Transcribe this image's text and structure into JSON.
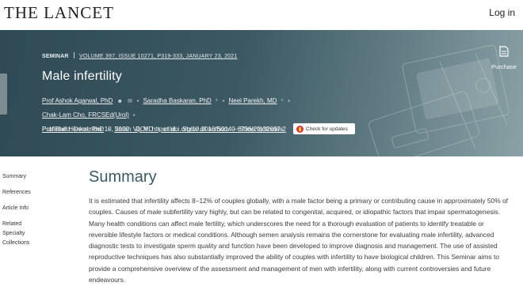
{
  "header": {
    "logo": "THE LANCET",
    "login": "Log in"
  },
  "article": {
    "section": "SEMINAR",
    "volume_info": "VOLUME 397, ISSUE 10271, P319-333, JANUARY 23, 2021",
    "title": "Male infertility",
    "authors": [
      "Prof Ashok Agarwal, PhD",
      "Saradha Baskaran, PhD",
      "Neel Parekh, MD",
      "Chak-Lam Cho, FRCSEd(Urol)",
      "Prof Ralf Henkel, PhD",
      "Sarah Vij, MD"
    ],
    "et_al": "et al.",
    "show_all_authors": "Show all authors",
    "show_footnotes": "Show footnotes",
    "published_label": "Published:",
    "published_date": "December 10, 2020",
    "doi_label": "DOI:",
    "doi": "https://doi.org/10.1016/S0140-6736(20)32667-2",
    "check_updates": "Check for updates",
    "purchase": "Purchase"
  },
  "nav": {
    "items": [
      "Summary",
      "References",
      "Article Info",
      "Related",
      "Specialty",
      "Collections"
    ]
  },
  "summary": {
    "heading": "Summary",
    "text": "It is estimated that infertility affects 8–12% of couples globally, with a male factor being a primary or contributing cause in approximately 50% of couples. Causes of male subfertility vary highly, but can be related to congenital, acquired, or idiopathic factors that impair spermatogenesis. Many health conditions can affect male fertility, which underscores the need for a thorough evaluation of patients to identify treatable or reversible lifestyle factors or medical conditions. Although semen analysis remains the cornerstone for evaluating male infertility, advanced diagnostic tests to investigate sperm quality and function have been developed to improve diagnosis and management. The use of assisted reproductive techniques has also substantially improved the ability of couples with infertility to have biological children. This Seminar aims to provide a comprehensive overview of the assessment and management of men with infertility, along with current controversies and future endeavours."
  },
  "colors": {
    "hero_dark": "#2f4a55",
    "summary_heading": "#3a5a67"
  }
}
